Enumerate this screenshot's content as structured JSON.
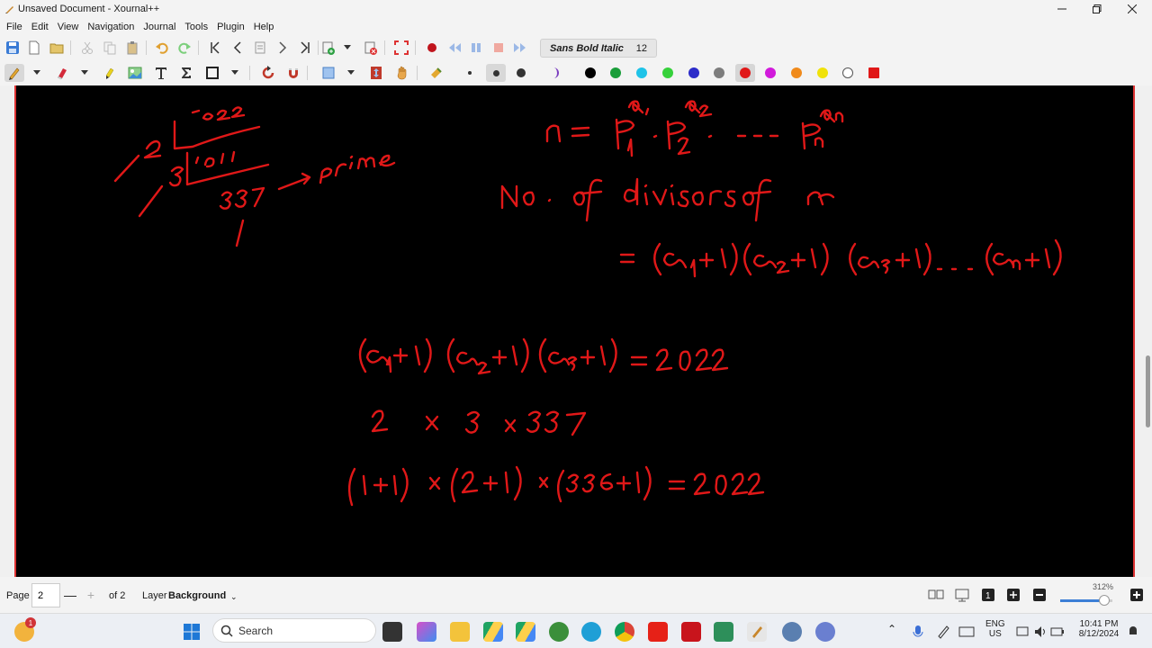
{
  "window": {
    "title": "Unsaved Document - Xournal++"
  },
  "menu": {
    "items": [
      "File",
      "Edit",
      "View",
      "Navigation",
      "Journal",
      "Tools",
      "Plugin",
      "Help"
    ]
  },
  "toolbar": {
    "font_name": "Sans Bold Italic",
    "font_size": "12",
    "pen_colors": [
      "#000000",
      "#1a9e3a",
      "#1fc3e8",
      "#36d13b",
      "#2c2cc9",
      "#7d7d7d",
      "#e01818",
      "#d11adb",
      "#f08a1b",
      "#f0e20a",
      "#ffffff",
      "#e01818"
    ],
    "selected_color": "#e01818"
  },
  "icons": {
    "app": "xournal-pen-icon",
    "save": "save-icon",
    "new": "new-document-icon",
    "open": "open-folder-icon",
    "cut": "cut-icon",
    "copy": "copy-icon",
    "paste": "paste-icon",
    "undo": "undo-icon",
    "redo": "redo-icon",
    "first_page": "first-page-icon",
    "prev_page": "previous-page-icon",
    "goto_page": "goto-page-icon",
    "next_page": "next-page-icon",
    "last_page": "last-page-icon",
    "insert_page": "insert-page-icon",
    "delete_page": "delete-page-icon",
    "fullscreen": "fullscreen-icon",
    "record": "record-icon",
    "rewind": "rewind-icon",
    "pause": "pause-icon",
    "stop": "stop-icon",
    "fast_forward": "fast-forward-icon",
    "pen": "pen-icon",
    "eraser": "eraser-icon",
    "highlighter": "highlighter-icon",
    "image": "image-icon",
    "text": "text-icon",
    "math": "sigma-icon",
    "shape": "rectangle-icon",
    "rotate_snap": "rotate-snap-icon",
    "grid_snap": "magnet-icon",
    "select_rect": "select-rectangle-icon",
    "vertical_space": "vertical-space-icon",
    "hand": "hand-icon",
    "fill": "fill-icon",
    "thin": "thin-line-icon",
    "medium": "medium-line-icon",
    "thick": "thick-line-icon",
    "color_picker": "color-picker-icon"
  },
  "statusbar": {
    "page_label": "Page",
    "page_value": "2",
    "minus": "—",
    "plus": "+",
    "of_pages": "of 2",
    "layer_label": "Layer",
    "layer_value": "Background",
    "zoom": "312%",
    "zoom_fraction": 0.85
  },
  "taskbar": {
    "search_label": "Search",
    "notification_count": "1",
    "lang_line1": "ENG",
    "lang_line2": "US",
    "time": "10:41 PM",
    "date": "8/12/2024"
  },
  "note": {
    "ink_color": "#e01818"
  }
}
